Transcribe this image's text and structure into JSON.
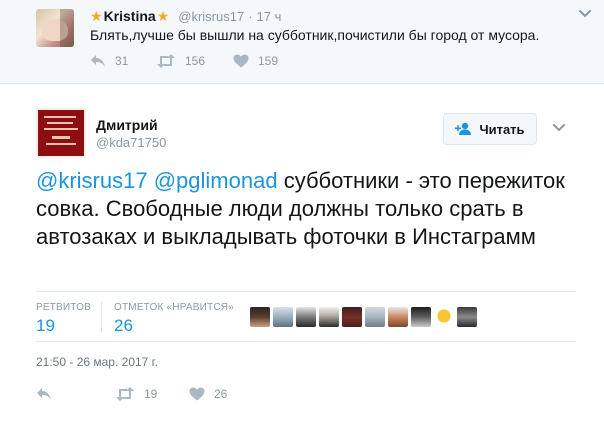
{
  "parent": {
    "name": "Kristina",
    "handle": "@krisrus17",
    "separator": "·",
    "time": "17 ч",
    "text": "Блять,лучше бы вышли на субботник,почистили бы город от мусора.",
    "retweets": "156",
    "likes": "159",
    "replies": "31",
    "star_icon": "star-emoji"
  },
  "main": {
    "name": "Дмитрий",
    "handle": "@kda71750",
    "follow_label": "Читать",
    "mention1": "@krisrus17",
    "mention2": "@pglimonad",
    "body": "субботники - это пережиток совка. Свободные люди должны только срать в автозаках и выкладывать фоточки в Инстаграмм",
    "stats": {
      "retweets_label": "РЕТВИТОВ",
      "retweets_value": "19",
      "likes_label": "ОТМЕТОК «НРАВИТСЯ»",
      "likes_value": "26"
    },
    "date": "21:50 - 26 мар. 2017 г.",
    "retweet_count": "19",
    "like_count": "26"
  },
  "colors": {
    "link": "#1b95e0",
    "muted": "#8899a6",
    "star": "#f5a623",
    "avatar_red": "#8e0d10"
  }
}
